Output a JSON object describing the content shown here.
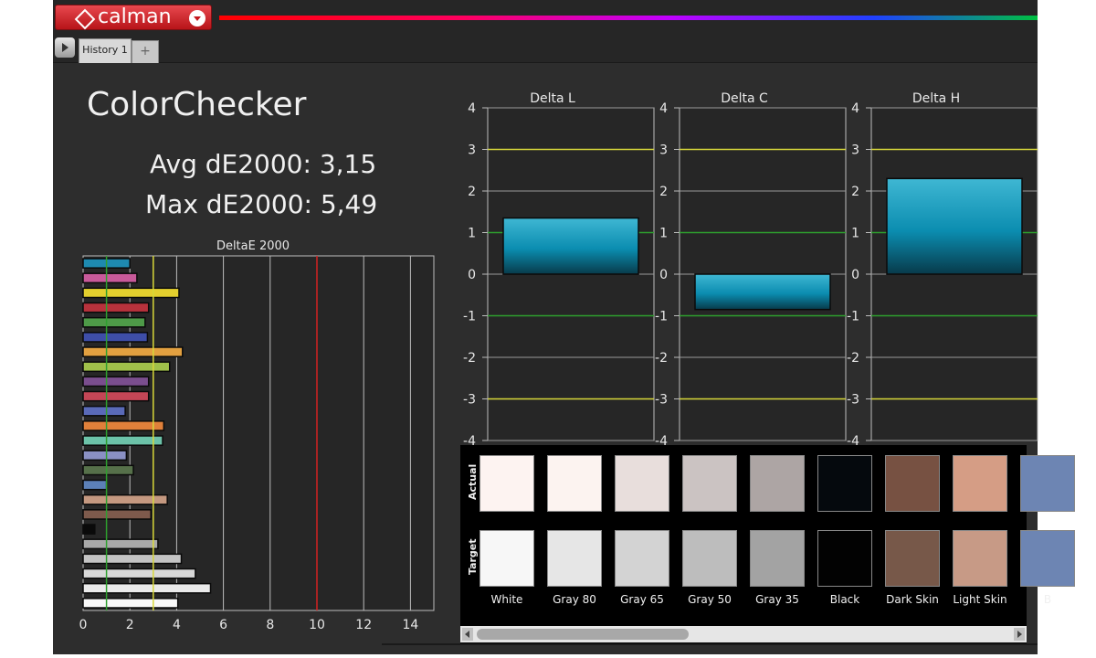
{
  "app": {
    "logo_text": "calman",
    "tab_label": "History 1",
    "add_tab": "+"
  },
  "header": {
    "title": "ColorChecker",
    "avg_label": "Avg dE2000: 3,15",
    "max_label": "Max dE2000: 5,49"
  },
  "swatch_panel": {
    "actual_label": "Actual",
    "target_label": "Target",
    "swatches": [
      {
        "name": "White",
        "actual": "#fdf3f1",
        "target": "#f7f7f7"
      },
      {
        "name": "Gray 80",
        "actual": "#fcf3f0",
        "target": "#e6e6e6"
      },
      {
        "name": "Gray 65",
        "actual": "#e8dedc",
        "target": "#d3d3d3"
      },
      {
        "name": "Gray 50",
        "actual": "#cbc3c2",
        "target": "#bdbdbd"
      },
      {
        "name": "Gray 35",
        "actual": "#ada5a4",
        "target": "#a3a3a3"
      },
      {
        "name": "Black",
        "actual": "#05090d",
        "target": "#020202"
      },
      {
        "name": "Dark Skin",
        "actual": "#775142",
        "target": "#775849"
      },
      {
        "name": "Light Skin",
        "actual": "#d59d85",
        "target": "#c79a86"
      },
      {
        "name": "B",
        "actual": "#6d85b3",
        "target": "#6d85b3"
      }
    ]
  },
  "chart_data": [
    {
      "type": "bar",
      "orientation": "horizontal",
      "title": "DeltaE 2000",
      "xlim": [
        0,
        15
      ],
      "xticks": [
        0,
        2,
        4,
        6,
        8,
        10,
        12,
        14
      ],
      "reference_lines": [
        {
          "value": 1,
          "color": "#2ea02e"
        },
        {
          "value": 3,
          "color": "#d8d83a"
        },
        {
          "value": 10,
          "color": "#d42020"
        }
      ],
      "bars": [
        {
          "value": 2.0,
          "color": "#1e8ab0"
        },
        {
          "value": 2.3,
          "color": "#c85a9a"
        },
        {
          "value": 4.1,
          "color": "#e3cf2e"
        },
        {
          "value": 2.8,
          "color": "#b8323c"
        },
        {
          "value": 2.65,
          "color": "#4e9a48"
        },
        {
          "value": 2.75,
          "color": "#3e4ea8"
        },
        {
          "value": 4.25,
          "color": "#e2a040"
        },
        {
          "value": 3.7,
          "color": "#a0c04a"
        },
        {
          "value": 2.8,
          "color": "#7a4e8e"
        },
        {
          "value": 2.8,
          "color": "#c44656"
        },
        {
          "value": 1.8,
          "color": "#5a6ab8"
        },
        {
          "value": 3.45,
          "color": "#e0803a"
        },
        {
          "value": 3.4,
          "color": "#6cc2a8"
        },
        {
          "value": 1.85,
          "color": "#8a90c4"
        },
        {
          "value": 2.15,
          "color": "#56704a"
        },
        {
          "value": 1.0,
          "color": "#5c80b8"
        },
        {
          "value": 3.6,
          "color": "#c49880"
        },
        {
          "value": 2.9,
          "color": "#7e5a4c"
        },
        {
          "value": 0.5,
          "color": "#0a0a0a"
        },
        {
          "value": 3.2,
          "color": "#a8a8a8"
        },
        {
          "value": 4.2,
          "color": "#c4c4c4"
        },
        {
          "value": 4.8,
          "color": "#d8d8d8"
        },
        {
          "value": 5.45,
          "color": "#eaeaea"
        },
        {
          "value": 4.05,
          "color": "#f8f8f8"
        }
      ]
    },
    {
      "type": "bar",
      "title": "Delta L",
      "ylim": [
        -4,
        4
      ],
      "yticks": [
        4,
        3,
        2,
        1,
        0,
        -1,
        -2,
        -3,
        -4
      ],
      "reference_lines": [
        {
          "value": 3,
          "color": "#d8d83a"
        },
        {
          "value": -3,
          "color": "#d8d83a"
        },
        {
          "value": 1,
          "color": "#2ea02e"
        },
        {
          "value": -1,
          "color": "#2ea02e"
        }
      ],
      "value": 1.35
    },
    {
      "type": "bar",
      "title": "Delta C",
      "ylim": [
        -4,
        4
      ],
      "yticks": [
        4,
        3,
        2,
        1,
        0,
        -1,
        -2,
        -3,
        -4
      ],
      "reference_lines": [
        {
          "value": 3,
          "color": "#d8d83a"
        },
        {
          "value": -3,
          "color": "#d8d83a"
        },
        {
          "value": 1,
          "color": "#2ea02e"
        },
        {
          "value": -1,
          "color": "#2ea02e"
        }
      ],
      "value": -0.85
    },
    {
      "type": "bar",
      "title": "Delta H",
      "ylim": [
        -4,
        4
      ],
      "yticks": [
        4,
        3,
        2,
        1,
        0,
        -1,
        -2,
        -3,
        -4
      ],
      "reference_lines": [
        {
          "value": 3,
          "color": "#d8d83a"
        },
        {
          "value": -3,
          "color": "#d8d83a"
        },
        {
          "value": 1,
          "color": "#2ea02e"
        },
        {
          "value": -1,
          "color": "#2ea02e"
        }
      ],
      "value": 2.3
    }
  ]
}
